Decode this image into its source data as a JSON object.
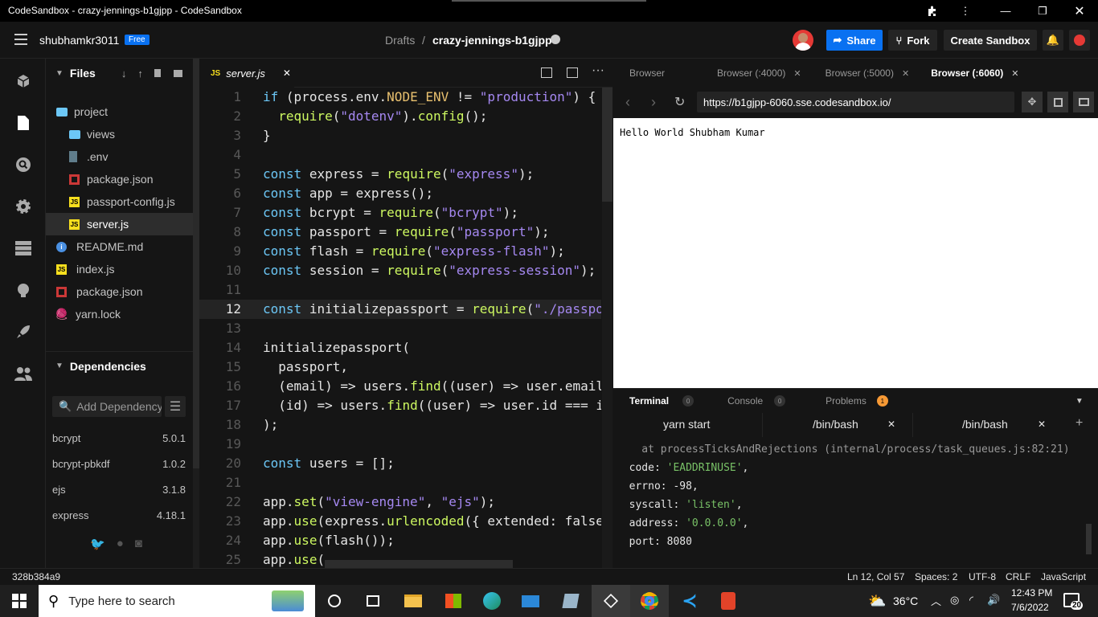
{
  "window": {
    "title": "CodeSandbox - crazy-jennings-b1gjpp - CodeSandbox"
  },
  "header": {
    "username": "shubhamkr3011",
    "plan_badge": "Free",
    "breadcrumb_parent": "Drafts",
    "breadcrumb_sep": "/",
    "sandbox_name": "crazy-jennings-b1gjpp",
    "share_label": "Share",
    "fork_label": "Fork",
    "create_label": "Create Sandbox"
  },
  "files": {
    "title": "Files",
    "tree": [
      {
        "name": "project",
        "type": "folder"
      },
      {
        "name": "views",
        "type": "folder"
      },
      {
        "name": ".env",
        "type": "file"
      },
      {
        "name": "package.json",
        "type": "npm"
      },
      {
        "name": "passport-config.js",
        "type": "js"
      },
      {
        "name": "server.js",
        "type": "js"
      },
      {
        "name": "README.md",
        "type": "info"
      },
      {
        "name": "index.js",
        "type": "js"
      },
      {
        "name": "package.json",
        "type": "npm"
      },
      {
        "name": "yarn.lock",
        "type": "yarn"
      }
    ]
  },
  "dependencies": {
    "title": "Dependencies",
    "add_placeholder": "Add Dependency",
    "items": [
      {
        "name": "bcrypt",
        "version": "5.0.1"
      },
      {
        "name": "bcrypt-pbkdf",
        "version": "1.0.2"
      },
      {
        "name": "ejs",
        "version": "3.1.8"
      },
      {
        "name": "express",
        "version": "4.18.1"
      }
    ]
  },
  "editor": {
    "tab_icon": "JS",
    "tab_name": "server.js",
    "lines": [
      {
        "n": "1",
        "t": "if (process.env.NODE_ENV != \"production\") {"
      },
      {
        "n": "2",
        "t": "  require(\"dotenv\").config();"
      },
      {
        "n": "3",
        "t": "}"
      },
      {
        "n": "4",
        "t": ""
      },
      {
        "n": "5",
        "t": "const express = require(\"express\");"
      },
      {
        "n": "6",
        "t": "const app = express();"
      },
      {
        "n": "7",
        "t": "const bcrypt = require(\"bcrypt\");"
      },
      {
        "n": "8",
        "t": "const passport = require(\"passport\");"
      },
      {
        "n": "9",
        "t": "const flash = require(\"express-flash\");"
      },
      {
        "n": "10",
        "t": "const session = require(\"express-session\");"
      },
      {
        "n": "11",
        "t": ""
      },
      {
        "n": "12",
        "t": "const initializepassport = require(\"./passport"
      },
      {
        "n": "13",
        "t": ""
      },
      {
        "n": "14",
        "t": "initializepassport("
      },
      {
        "n": "15",
        "t": "  passport,"
      },
      {
        "n": "16",
        "t": "  (email) => users.find((user) => user.email ="
      },
      {
        "n": "17",
        "t": "  (id) => users.find((user) => user.id === id"
      },
      {
        "n": "18",
        "t": ");"
      },
      {
        "n": "19",
        "t": ""
      },
      {
        "n": "20",
        "t": "const users = [];"
      },
      {
        "n": "21",
        "t": ""
      },
      {
        "n": "22",
        "t": "app.set(\"view-engine\", \"ejs\");"
      },
      {
        "n": "23",
        "t": "app.use(express.urlencoded({ extended: false }"
      },
      {
        "n": "24",
        "t": "app.use(flash());"
      },
      {
        "n": "25",
        "t": "app.use("
      }
    ]
  },
  "browser": {
    "tabs": [
      "Browser",
      "Browser (:4000)",
      "Browser (:5000)",
      "Browser (:6060)"
    ],
    "url": "https://b1gjpp-6060.sse.codesandbox.io/",
    "content": "Hello World Shubham Kumar"
  },
  "terminal": {
    "tabs": [
      {
        "label": "Terminal",
        "count": "0"
      },
      {
        "label": "Console",
        "count": "0"
      },
      {
        "label": "Problems",
        "count": "1"
      }
    ],
    "shells": [
      "yarn start",
      "/bin/bash",
      "/bin/bash"
    ],
    "lines": [
      {
        "k": "    at processTicksAndRejections (internal/process/task_queues.js:82:21)",
        "v": ""
      },
      {
        "k": "  code: ",
        "v": "'EADDRINUSE'",
        "e": ","
      },
      {
        "k": "  errno: -98,",
        "v": ""
      },
      {
        "k": "  syscall: ",
        "v": "'listen'",
        "e": ","
      },
      {
        "k": "  address: ",
        "v": "'0.0.0.0'",
        "e": ","
      },
      {
        "k": "  port: 8080",
        "v": ""
      }
    ]
  },
  "status": {
    "commit": "328b384a9",
    "position": "Ln 12, Col 57",
    "spaces": "Spaces: 2",
    "encoding": "UTF-8",
    "eol": "CRLF",
    "language": "JavaScript"
  },
  "taskbar": {
    "search_placeholder": "Type here to search",
    "temperature": "36°C",
    "time": "12:43 PM",
    "date": "7/6/2022",
    "notif_count": "20"
  }
}
